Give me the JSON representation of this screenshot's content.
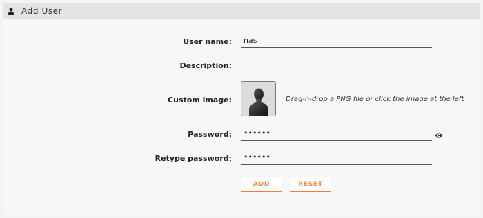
{
  "header": {
    "title": "Add User",
    "icon": "user-icon"
  },
  "form": {
    "username": {
      "label": "User name:",
      "value": "nas"
    },
    "description": {
      "label": "Description:",
      "value": ""
    },
    "custom_image": {
      "label": "Custom image:",
      "hint": "Drag-n-drop a PNG file or click the image at the left",
      "icon": "avatar-silhouette-icon"
    },
    "password": {
      "label": "Password:",
      "value": "••••••",
      "toggle_icon": "eye-icon"
    },
    "retype_password": {
      "label": "Retype password:",
      "value": "••••••"
    }
  },
  "buttons": {
    "add": "ADD",
    "reset": "RESET"
  },
  "colors": {
    "button_border": "#e4563c",
    "button_text": "#f08a3c",
    "header_bg": "#e4e4e4"
  }
}
